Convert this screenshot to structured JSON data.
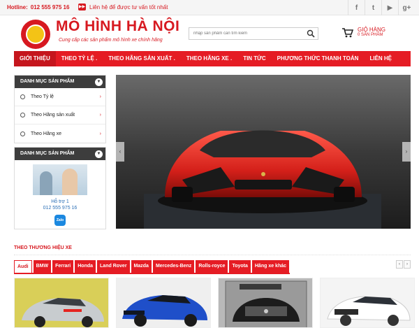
{
  "topbar": {
    "hotline_label": "Hotline:",
    "hotline_number": "012 555 975 16",
    "advice_text": "Liên hệ để được tư vấn tốt nhất",
    "social": [
      {
        "icon": "facebook-icon",
        "glyph": "f"
      },
      {
        "icon": "twitter-icon",
        "glyph": "t"
      },
      {
        "icon": "youtube-icon",
        "glyph": "▶"
      },
      {
        "icon": "google-plus-icon",
        "glyph": "g+"
      }
    ]
  },
  "header": {
    "brand": "MÔ HÌNH HÀ NỘI",
    "slogan": "Cung cấp các sản phẩm mô hình xe chính hãng",
    "search_placeholder": "nhập sản phẩm cần tìm kiếm",
    "cart_title": "GIỎ HÀNG",
    "cart_count": "0 SẢN PHẨM"
  },
  "nav": {
    "items": [
      "GIỚI THIỆU",
      "THEO TỶ LỆ .",
      "THEO HÃNG SẢN XUẤT .",
      "THEO HÃNG XE .",
      "TIN TỨC",
      "PHƯƠNG THỨC THANH TOÁN",
      "LIÊN HỆ"
    ]
  },
  "sidebar": {
    "category_title": "DANH MỤC SẢN PHẨM",
    "categories": [
      "Theo Tỷ lệ",
      "Theo Hãng sản xuất",
      "Theo Hãng xe"
    ],
    "support_title": "DANH MỤC SẢN PHẨM",
    "support_name": "Hỗ trợ 1",
    "support_phone": "012 555 975 16",
    "zalo_label": "Zalo"
  },
  "brands": {
    "title": "THEO THƯƠNG HIỆU XE",
    "tabs": [
      "Audi",
      "BMW",
      "Ferrari",
      "Honda",
      "Land Rover",
      "Mazda",
      "Mercedes-Benz",
      "Rolls-royce",
      "Toyota",
      "Hãng xe khác"
    ],
    "active_tab": 0
  },
  "colors": {
    "accent": "#e51c24",
    "dark": "#3d3d3d",
    "link": "#2b6fb6"
  }
}
